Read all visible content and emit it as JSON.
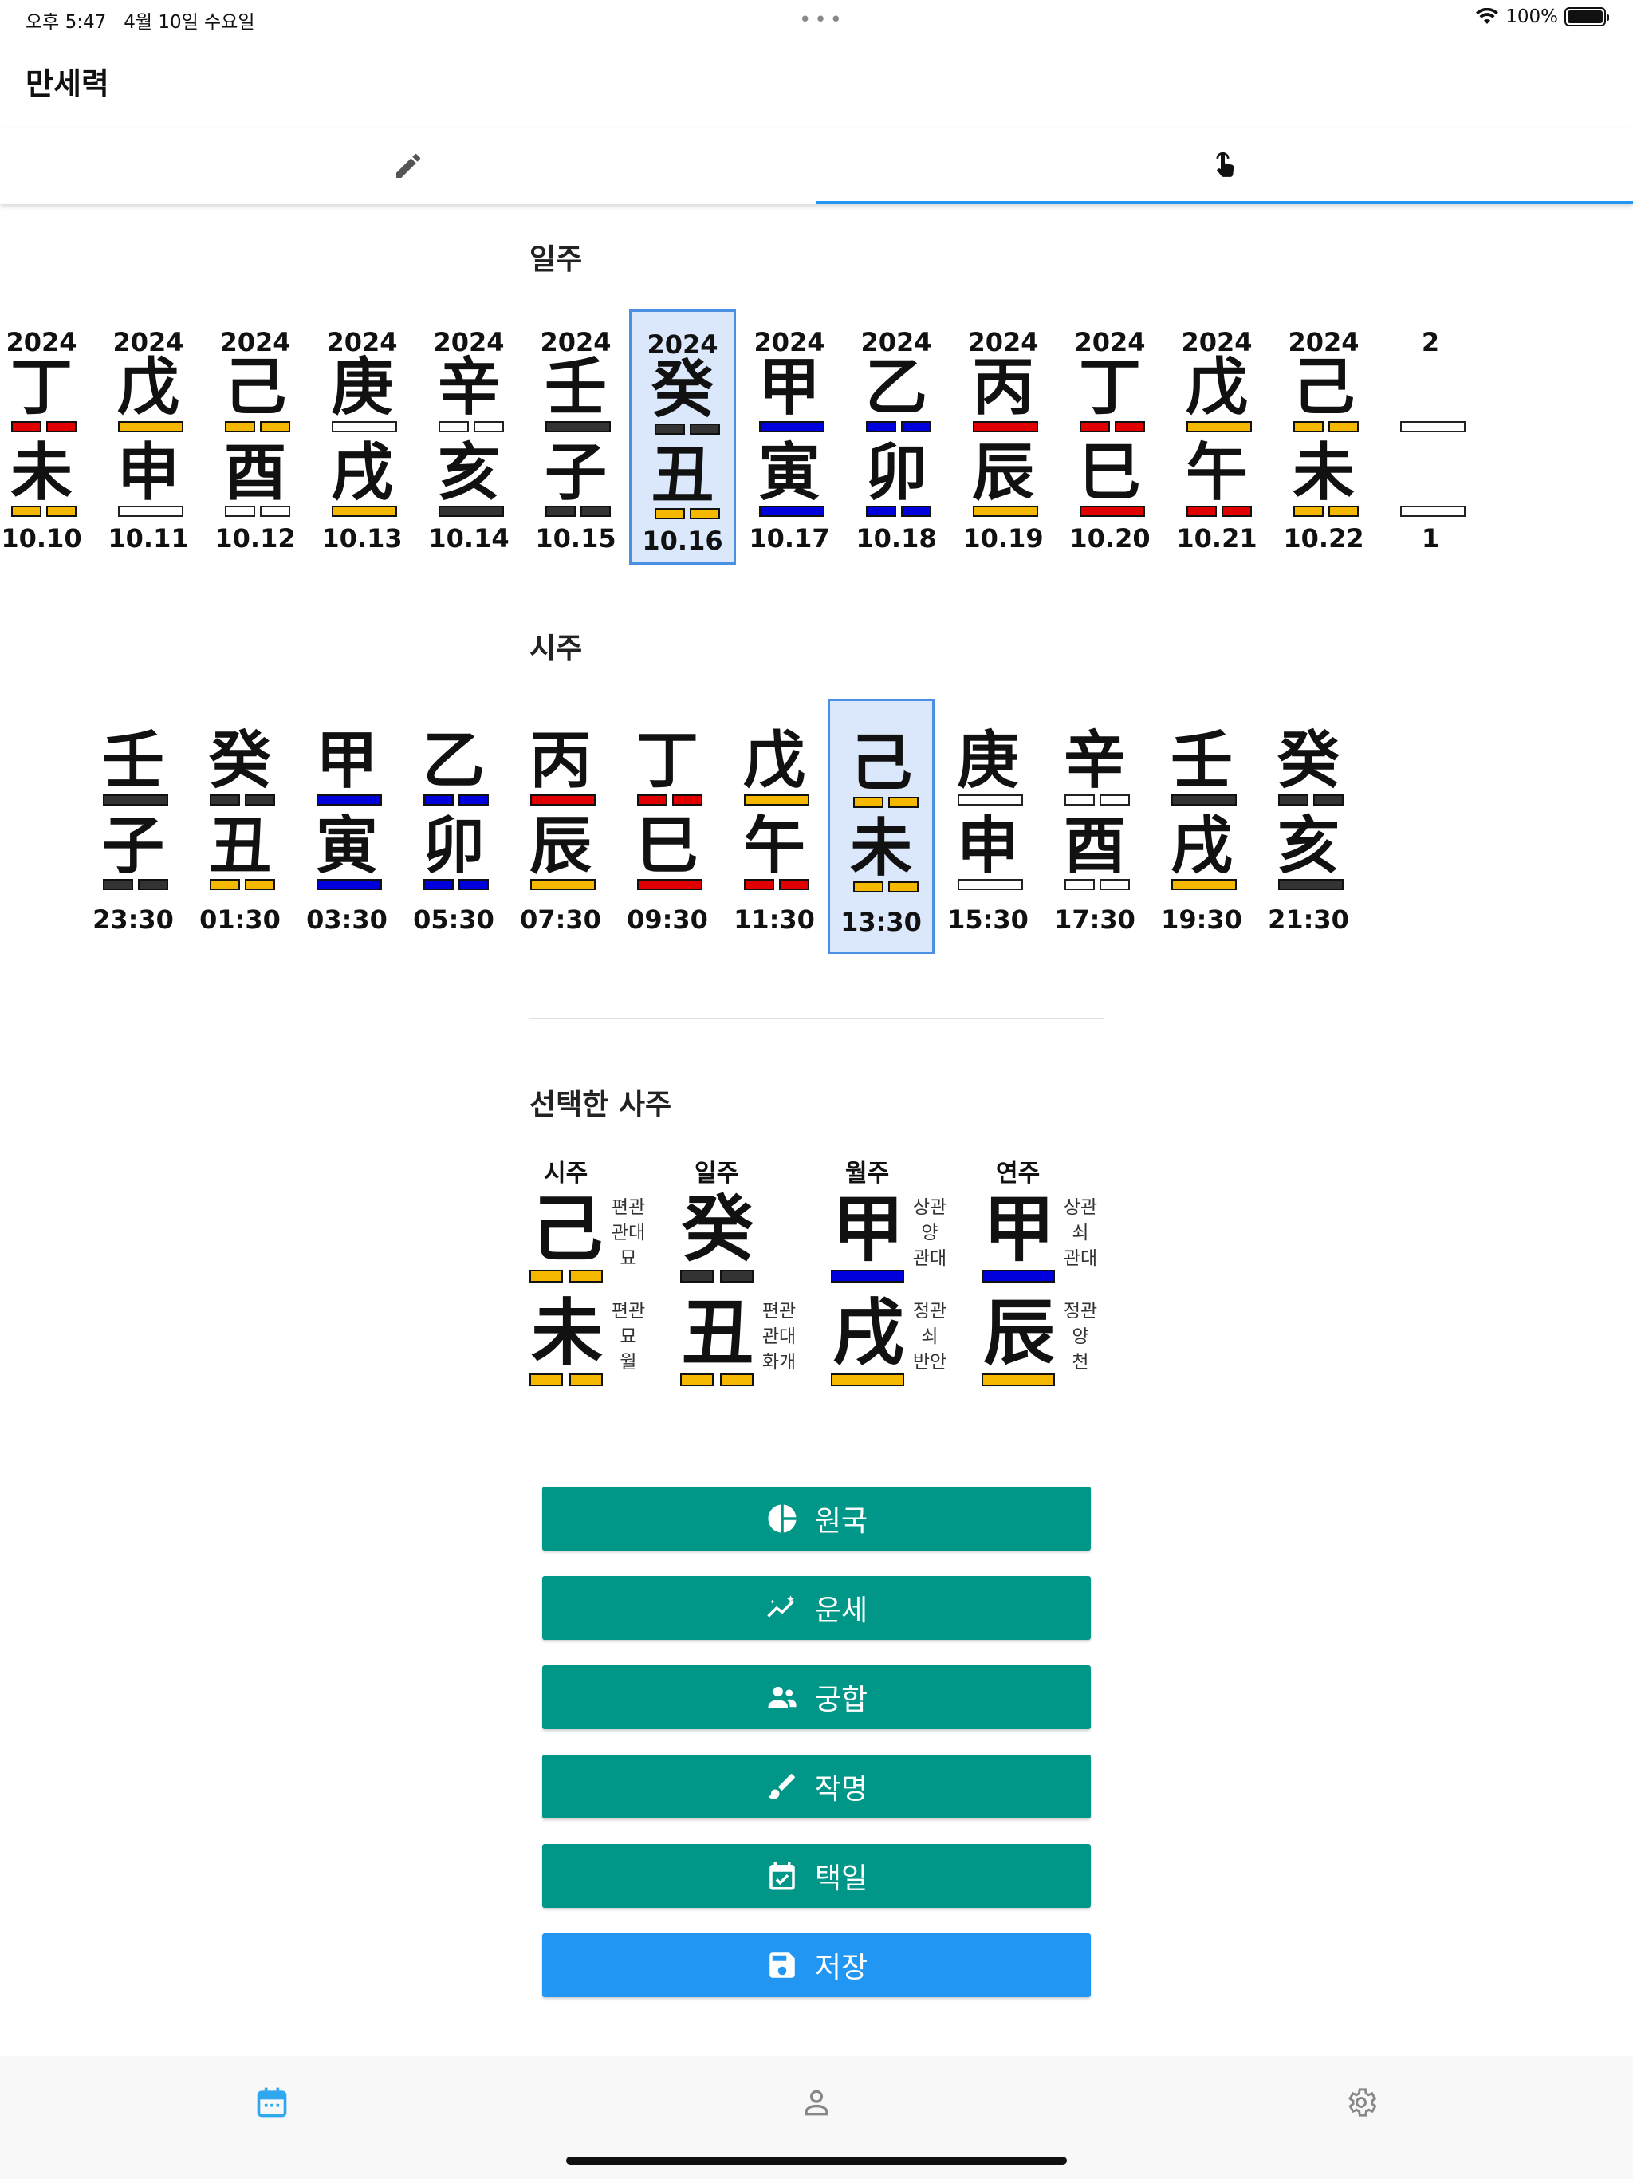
{
  "status_bar": {
    "time": "오후 5:47",
    "date": "4월 10일 수요일",
    "battery": "100%"
  },
  "app": {
    "title": "만세력"
  },
  "tabs": [
    {
      "icon": "pencil-icon"
    },
    {
      "icon": "touch-icon"
    }
  ],
  "day_section": {
    "title": "일주",
    "items": [
      {
        "year": "2024",
        "stem": "丁",
        "stem_color": "red",
        "stem_bar": "split",
        "branch": "未",
        "branch_color": "yellow",
        "branch_bar": "split",
        "date": "10.10"
      },
      {
        "year": "2024",
        "stem": "戊",
        "stem_color": "yellow",
        "stem_bar": "solid",
        "branch": "申",
        "branch_color": "white",
        "branch_bar": "solid",
        "date": "10.11"
      },
      {
        "year": "2024",
        "stem": "己",
        "stem_color": "yellow",
        "stem_bar": "split",
        "branch": "酉",
        "branch_color": "white",
        "branch_bar": "split",
        "date": "10.12"
      },
      {
        "year": "2024",
        "stem": "庚",
        "stem_color": "white",
        "stem_bar": "solid",
        "branch": "戌",
        "branch_color": "yellow",
        "branch_bar": "solid",
        "date": "10.13"
      },
      {
        "year": "2024",
        "stem": "辛",
        "stem_color": "white",
        "stem_bar": "split",
        "branch": "亥",
        "branch_color": "black",
        "branch_bar": "solid",
        "date": "10.14"
      },
      {
        "year": "2024",
        "stem": "壬",
        "stem_color": "black",
        "stem_bar": "solid",
        "branch": "子",
        "branch_color": "black",
        "branch_bar": "split",
        "date": "10.15"
      },
      {
        "year": "2024",
        "stem": "癸",
        "stem_color": "black",
        "stem_bar": "split",
        "branch": "丑",
        "branch_color": "yellow",
        "branch_bar": "split",
        "date": "10.16",
        "selected": true
      },
      {
        "year": "2024",
        "stem": "甲",
        "stem_color": "blue",
        "stem_bar": "solid",
        "branch": "寅",
        "branch_color": "blue",
        "branch_bar": "solid",
        "date": "10.17"
      },
      {
        "year": "2024",
        "stem": "乙",
        "stem_color": "blue",
        "stem_bar": "split",
        "branch": "卯",
        "branch_color": "blue",
        "branch_bar": "split",
        "date": "10.18"
      },
      {
        "year": "2024",
        "stem": "丙",
        "stem_color": "red",
        "stem_bar": "solid",
        "branch": "辰",
        "branch_color": "yellow",
        "branch_bar": "solid",
        "date": "10.19"
      },
      {
        "year": "2024",
        "stem": "丁",
        "stem_color": "red",
        "stem_bar": "split",
        "branch": "巳",
        "branch_color": "red",
        "branch_bar": "solid",
        "date": "10.20"
      },
      {
        "year": "2024",
        "stem": "戊",
        "stem_color": "yellow",
        "stem_bar": "solid",
        "branch": "午",
        "branch_color": "red",
        "branch_bar": "split",
        "date": "10.21"
      },
      {
        "year": "2024",
        "stem": "己",
        "stem_color": "yellow",
        "stem_bar": "split",
        "branch": "未",
        "branch_color": "yellow",
        "branch_bar": "split",
        "date": "10.22"
      },
      {
        "year": "2",
        "stem": "",
        "stem_color": "white",
        "stem_bar": "solid",
        "branch": "",
        "branch_color": "white",
        "branch_bar": "solid",
        "date": "1"
      }
    ]
  },
  "hour_section": {
    "title": "시주",
    "items": [
      {
        "stem": "壬",
        "stem_color": "black",
        "stem_bar": "solid",
        "branch": "子",
        "branch_color": "black",
        "branch_bar": "split",
        "time": "23:30"
      },
      {
        "stem": "癸",
        "stem_color": "black",
        "stem_bar": "split",
        "branch": "丑",
        "branch_color": "yellow",
        "branch_bar": "split",
        "time": "01:30"
      },
      {
        "stem": "甲",
        "stem_color": "blue",
        "stem_bar": "solid",
        "branch": "寅",
        "branch_color": "blue",
        "branch_bar": "solid",
        "time": "03:30"
      },
      {
        "stem": "乙",
        "stem_color": "blue",
        "stem_bar": "split",
        "branch": "卯",
        "branch_color": "blue",
        "branch_bar": "split",
        "time": "05:30"
      },
      {
        "stem": "丙",
        "stem_color": "red",
        "stem_bar": "solid",
        "branch": "辰",
        "branch_color": "yellow",
        "branch_bar": "solid",
        "time": "07:30"
      },
      {
        "stem": "丁",
        "stem_color": "red",
        "stem_bar": "split",
        "branch": "巳",
        "branch_color": "red",
        "branch_bar": "solid",
        "time": "09:30"
      },
      {
        "stem": "戊",
        "stem_color": "yellow",
        "stem_bar": "solid",
        "branch": "午",
        "branch_color": "red",
        "branch_bar": "split",
        "time": "11:30"
      },
      {
        "stem": "己",
        "stem_color": "yellow",
        "stem_bar": "split",
        "branch": "未",
        "branch_color": "yellow",
        "branch_bar": "split",
        "time": "13:30",
        "selected": true
      },
      {
        "stem": "庚",
        "stem_color": "white",
        "stem_bar": "solid",
        "branch": "申",
        "branch_color": "white",
        "branch_bar": "solid",
        "time": "15:30"
      },
      {
        "stem": "辛",
        "stem_color": "white",
        "stem_bar": "split",
        "branch": "酉",
        "branch_color": "white",
        "branch_bar": "split",
        "time": "17:30"
      },
      {
        "stem": "壬",
        "stem_color": "black",
        "stem_bar": "solid",
        "branch": "戌",
        "branch_color": "yellow",
        "branch_bar": "solid",
        "time": "19:30"
      },
      {
        "stem": "癸",
        "stem_color": "black",
        "stem_bar": "split",
        "branch": "亥",
        "branch_color": "black",
        "branch_bar": "solid",
        "time": "21:30"
      }
    ]
  },
  "selected_saju": {
    "title": "선택한 사주",
    "columns": [
      {
        "label": "시주",
        "stem": "己",
        "stem_color": "yellow",
        "stem_bar": "split",
        "stem_info": [
          "편관",
          "관대",
          "묘"
        ],
        "branch": "未",
        "branch_color": "yellow",
        "branch_bar": "split",
        "branch_info": [
          "편관",
          "묘",
          "월"
        ]
      },
      {
        "label": "일주",
        "stem": "癸",
        "stem_color": "black",
        "stem_bar": "split",
        "stem_info": [
          "",
          "",
          ""
        ],
        "branch": "丑",
        "branch_color": "yellow",
        "branch_bar": "split",
        "branch_info": [
          "편관",
          "관대",
          "화개"
        ]
      },
      {
        "label": "월주",
        "stem": "甲",
        "stem_color": "blue",
        "stem_bar": "solid",
        "stem_info": [
          "상관",
          "양",
          "관대"
        ],
        "branch": "戌",
        "branch_color": "yellow",
        "branch_bar": "solid",
        "branch_info": [
          "정관",
          "쇠",
          "반안"
        ]
      },
      {
        "label": "연주",
        "stem": "甲",
        "stem_color": "blue",
        "stem_bar": "solid",
        "stem_info": [
          "상관",
          "쇠",
          "관대"
        ],
        "branch": "辰",
        "branch_color": "yellow",
        "branch_bar": "solid",
        "branch_info": [
          "정관",
          "양",
          "천"
        ]
      }
    ]
  },
  "actions": [
    {
      "label": "원국",
      "icon": "pie-chart-icon"
    },
    {
      "label": "운세",
      "icon": "trend-icon"
    },
    {
      "label": "궁합",
      "icon": "people-icon"
    },
    {
      "label": "작명",
      "icon": "brush-icon"
    },
    {
      "label": "택일",
      "icon": "calendar-check-icon"
    },
    {
      "label": "저장",
      "icon": "save-icon"
    }
  ],
  "bottom_nav": [
    {
      "icon": "calendar-icon",
      "active": true,
      "color": "#2fa8f0"
    },
    {
      "icon": "person-icon",
      "active": false,
      "color": "#888888"
    },
    {
      "icon": "gear-icon",
      "active": false,
      "color": "#888888"
    }
  ]
}
